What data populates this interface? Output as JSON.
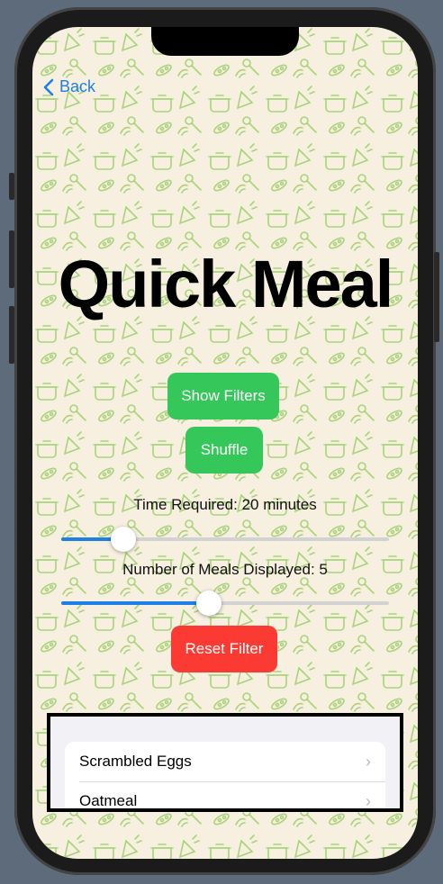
{
  "nav": {
    "back_label": "Back"
  },
  "title": "Quick Meal",
  "buttons": {
    "show_filters": "Show Filters",
    "shuffle": "Shuffle",
    "reset_filter": "Reset Filter"
  },
  "sliders": {
    "time": {
      "label": "Time Required: 20 minutes",
      "fraction": 0.19
    },
    "meals": {
      "label": "Number of Meals Displayed: 5",
      "fraction": 0.45
    }
  },
  "meals": [
    "Scrambled Eggs",
    "Oatmeal"
  ],
  "colors": {
    "accent": "#1e7fe6",
    "green": "#35c75a",
    "red": "#fb3b33",
    "background": "#f7efdf",
    "pattern": "#9ccc65"
  }
}
